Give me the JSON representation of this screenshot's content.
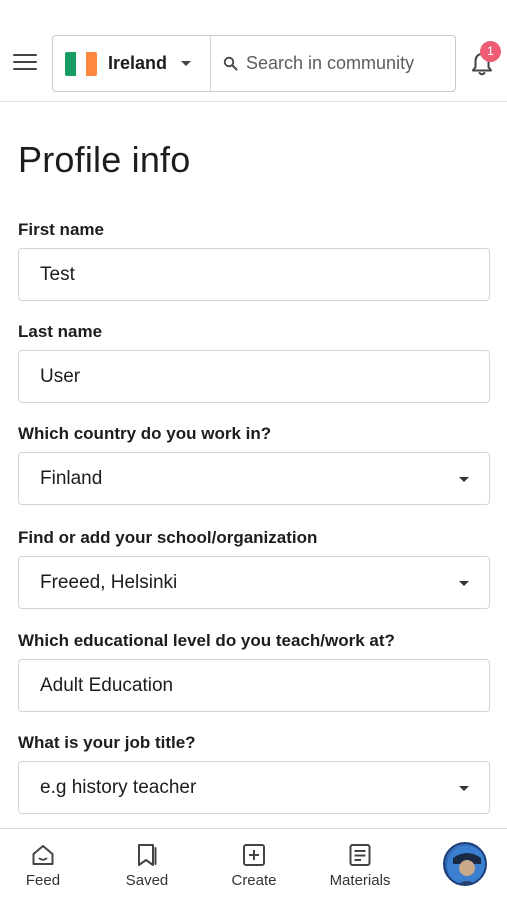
{
  "header": {
    "country_selector": {
      "label": "Ireland",
      "flag_colors": [
        "#169b62",
        "#ffffff",
        "#ff883e"
      ]
    },
    "search": {
      "placeholder": "Search in community"
    },
    "notifications": {
      "count": "1"
    }
  },
  "page": {
    "title": "Profile info"
  },
  "form": {
    "first_name": {
      "label": "First name",
      "value": "Test"
    },
    "last_name": {
      "label": "Last name",
      "value": "User"
    },
    "country": {
      "label": "Which country do you work in?",
      "value": "Finland"
    },
    "school": {
      "label": "Find or add your school/organization",
      "value": "Freeed, Helsinki"
    },
    "level": {
      "label": "Which educational level do you teach/work at?",
      "value": "Adult Education"
    },
    "job_title": {
      "label": "What is your job title?",
      "placeholder": "e.g history teacher"
    }
  },
  "bottom_nav": {
    "items": [
      {
        "label": "Feed",
        "icon": "home-icon"
      },
      {
        "label": "Saved",
        "icon": "bookmark-icon"
      },
      {
        "label": "Create",
        "icon": "plus-square-icon"
      },
      {
        "label": "Materials",
        "icon": "document-icon"
      }
    ],
    "profile_icon": "avatar"
  },
  "colors": {
    "badge": "#ee5d74",
    "border": "#d4d4d4",
    "text": "#1d1d1f"
  }
}
